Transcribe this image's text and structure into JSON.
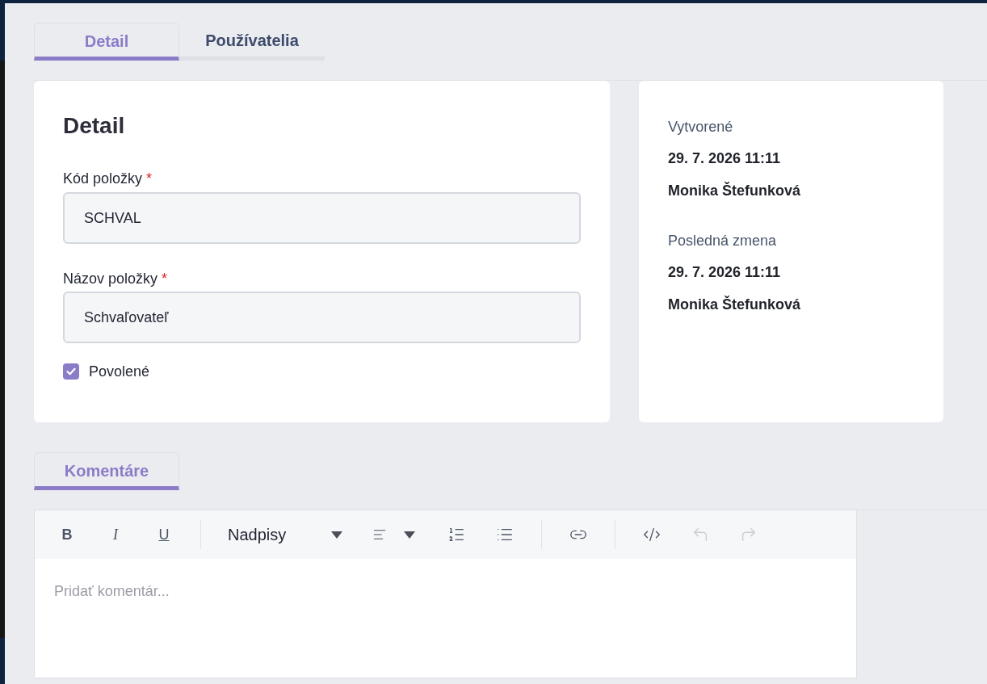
{
  "tabs": [
    {
      "label": "Detail",
      "selected": true
    },
    {
      "label": "Používatelia",
      "selected": false
    }
  ],
  "detail_card": {
    "title": "Detail",
    "fields": [
      {
        "label": "Kód položky",
        "required_mark": "*",
        "value": "SCHVAL"
      },
      {
        "label": "Názov položky",
        "required_mark": "*",
        "value": "Schvaľovateľ"
      }
    ],
    "checkbox": {
      "label": "Povolené",
      "checked": true
    }
  },
  "audit_card": {
    "entries": [
      {
        "label": "Vytvorené",
        "date": "29. 7. 2026 11:11",
        "user": "Monika Štefunková"
      },
      {
        "label": "Posledná zmena",
        "date": "29. 7. 2026 11:11",
        "user": "Monika Štefunková"
      }
    ]
  },
  "comment_tabs": [
    {
      "label": "Komentáre",
      "selected": true
    }
  ],
  "editor": {
    "toolbar": [
      {
        "kind": "bold",
        "label": "B",
        "disabled": false
      },
      {
        "kind": "italic",
        "label": "I",
        "disabled": false
      },
      {
        "kind": "underline",
        "label": "U",
        "disabled": false
      },
      {
        "kind": "separator"
      },
      {
        "kind": "heading",
        "label": "Nadpisy",
        "disabled": false
      },
      {
        "kind": "align",
        "disabled": false
      },
      {
        "kind": "olist",
        "disabled": false
      },
      {
        "kind": "ulist",
        "disabled": false
      },
      {
        "kind": "separator"
      },
      {
        "kind": "link",
        "disabled": false
      },
      {
        "kind": "separator"
      },
      {
        "kind": "code",
        "disabled": false
      },
      {
        "kind": "undo",
        "disabled": true
      },
      {
        "kind": "redo",
        "disabled": true
      }
    ],
    "placeholder": "Pridať komentár..."
  }
}
